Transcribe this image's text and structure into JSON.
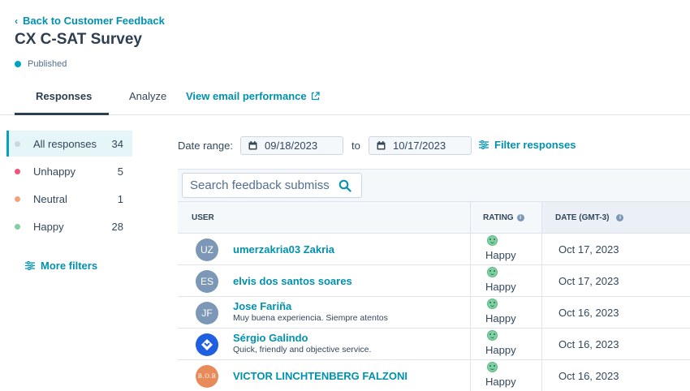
{
  "header": {
    "back_link": "Back to Customer Feedback",
    "title": "CX C-SAT Survey",
    "status": "Published",
    "status_color": "#00a4bd"
  },
  "tabs": [
    {
      "label": "Responses",
      "active": true
    },
    {
      "label": "Analyze",
      "active": false
    },
    {
      "label": "View email performance",
      "icon": "external-link-icon"
    }
  ],
  "sidebar": {
    "items": [
      {
        "label": "All responses",
        "count": "34",
        "color": "#cbd6e2",
        "active": true
      },
      {
        "label": "Unhappy",
        "count": "5",
        "color": "#f2547d"
      },
      {
        "label": "Neutral",
        "count": "1",
        "color": "#f5a17a"
      },
      {
        "label": "Happy",
        "count": "28",
        "color": "#7fd1a4"
      }
    ],
    "more_filters": "More filters"
  },
  "filters": {
    "date_range_label": "Date range:",
    "from_date": "09/18/2023",
    "to_label": "to",
    "to_date": "10/17/2023",
    "filter_responses": "Filter responses"
  },
  "search": {
    "placeholder": "Search feedback submiss"
  },
  "table": {
    "columns": [
      "USER",
      "RATING",
      "DATE (GMT-3)"
    ],
    "rows": [
      {
        "initials": "UZ",
        "name": "umerzakria03 Zakria",
        "comment": "",
        "rating": "Happy",
        "date": "Oct 17, 2023"
      },
      {
        "initials": "ES",
        "name": "elvis dos santos soares",
        "comment": "",
        "rating": "Happy",
        "date": "Oct 17, 2023"
      },
      {
        "initials": "JF",
        "name": "Jose Fariña",
        "comment": "Muy buena experiencia. Siempre atentos",
        "rating": "Happy",
        "date": "Oct 16, 2023"
      },
      {
        "initials": "",
        "name": "Sérgio Galindo",
        "comment": "Quick, friendly and objective service.",
        "rating": "Happy",
        "date": "Oct 16, 2023"
      },
      {
        "initials": "B.O.B",
        "name": "VICTOR LINCHTENBERG FALZONI",
        "comment": "",
        "rating": "Happy",
        "date": "Oct 16, 2023"
      }
    ]
  }
}
